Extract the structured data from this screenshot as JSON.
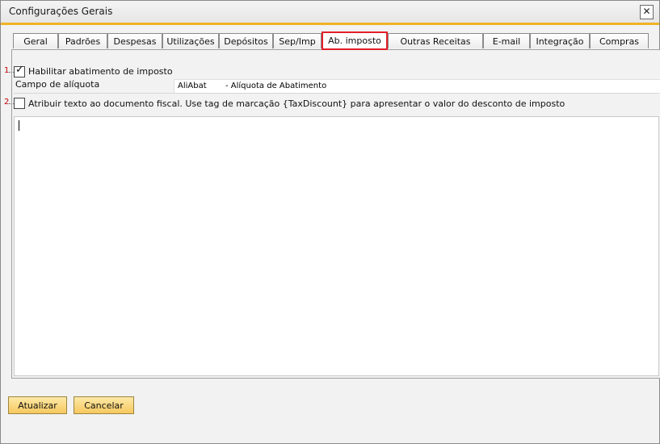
{
  "window": {
    "title": "Configurações Gerais",
    "close_symbol": "✕"
  },
  "tabs": [
    {
      "label": "Geral",
      "active": false
    },
    {
      "label": "Padrões",
      "active": false
    },
    {
      "label": "Despesas",
      "active": false
    },
    {
      "label": "Utilizações",
      "active": false
    },
    {
      "label": "Depósitos",
      "active": false
    },
    {
      "label": "Sep/Imp",
      "active": false
    },
    {
      "label": "Ab. imposto",
      "active": true
    },
    {
      "label": "Outras Receitas",
      "active": false
    },
    {
      "label": "E-mail",
      "active": false
    },
    {
      "label": "Integração",
      "active": false
    },
    {
      "label": "Compras",
      "active": false
    }
  ],
  "options": {
    "enable_number": "1",
    "enable_label": "Habilitar abatimento de imposto",
    "enable_checked": true,
    "rate_field_label": "Campo de alíquota",
    "rate_field_code": "AliAbat",
    "rate_field_desc": "- Alíquota de Abatimento",
    "attribute_number": "2",
    "attribute_label": "Atribuir texto ao documento fiscal. Use tag de marcação {TaxDiscount} para apresentar o valor do desconto de imposto",
    "attribute_checked": false,
    "text_content": ""
  },
  "buttons": {
    "update_label": "Atualizar",
    "cancel_label": "Cancelar"
  },
  "colors": {
    "accent": "#f0b325",
    "highlight": "#e0202a",
    "button_fill": "#f6c85e"
  }
}
